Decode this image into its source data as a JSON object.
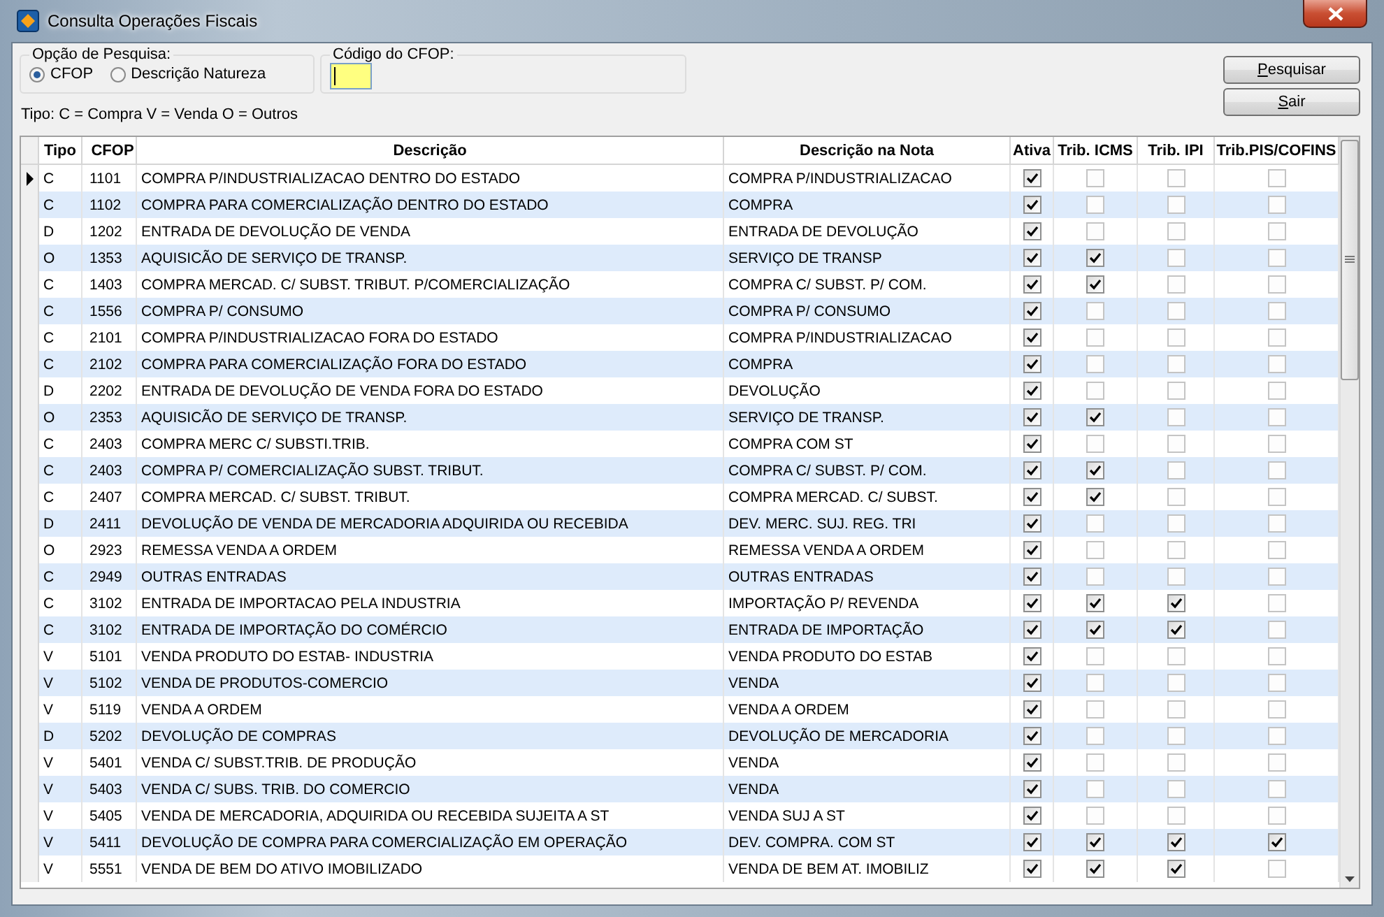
{
  "window": {
    "title": "Consulta Operações Fiscais"
  },
  "search_option": {
    "label": "Opção de Pesquisa:",
    "options": [
      {
        "label": "CFOP",
        "selected": true
      },
      {
        "label": "Descrição Natureza",
        "selected": false
      }
    ]
  },
  "cfop_code": {
    "label": "Código do CFOP:"
  },
  "buttons": [
    "Pesquisar",
    "Sair"
  ],
  "legend": "Tipo: C = Compra  V = Venda  O = Outros",
  "table": {
    "columns": [
      "Tipo",
      "CFOP",
      "Descrição",
      "Descrição na Nota",
      "Ativa",
      "Trib. ICMS",
      "Trib. IPI",
      "Trib.PIS/COFINS"
    ],
    "rows": [
      {
        "selected": true,
        "tipo": "C",
        "cfop": "1101",
        "descricao": "COMPRA P/INDUSTRIALIZACAO DENTRO DO ESTADO",
        "nota": "COMPRA P/INDUSTRIALIZACAO",
        "ativa": true,
        "icms": false,
        "ipi": false,
        "pis": false
      },
      {
        "selected": false,
        "tipo": "C",
        "cfop": "1102",
        "descricao": "COMPRA PARA COMERCIALIZAÇÃO DENTRO DO ESTADO",
        "nota": "COMPRA",
        "ativa": true,
        "icms": false,
        "ipi": false,
        "pis": false
      },
      {
        "selected": false,
        "tipo": "D",
        "cfop": "1202",
        "descricao": "ENTRADA DE DEVOLUÇÃO DE VENDA",
        "nota": "ENTRADA DE DEVOLUÇÃO",
        "ativa": true,
        "icms": false,
        "ipi": false,
        "pis": false
      },
      {
        "selected": false,
        "tipo": "O",
        "cfop": "1353",
        "descricao": "AQUISICÃO DE SERVIÇO DE TRANSP.",
        "nota": "SERVIÇO DE TRANSP",
        "ativa": true,
        "icms": true,
        "ipi": false,
        "pis": false
      },
      {
        "selected": false,
        "tipo": "C",
        "cfop": "1403",
        "descricao": "COMPRA MERCAD. C/ SUBST. TRIBUT. P/COMERCIALIZAÇÃO",
        "nota": "COMPRA C/ SUBST. P/ COM.",
        "ativa": true,
        "icms": true,
        "ipi": false,
        "pis": false
      },
      {
        "selected": false,
        "tipo": "C",
        "cfop": "1556",
        "descricao": "COMPRA P/ CONSUMO",
        "nota": "COMPRA P/ CONSUMO",
        "ativa": true,
        "icms": false,
        "ipi": false,
        "pis": false
      },
      {
        "selected": false,
        "tipo": "C",
        "cfop": "2101",
        "descricao": "COMPRA P/INDUSTRIALIZACAO FORA DO ESTADO",
        "nota": "COMPRA P/INDUSTRIALIZACAO",
        "ativa": true,
        "icms": false,
        "ipi": false,
        "pis": false
      },
      {
        "selected": false,
        "tipo": "C",
        "cfop": "2102",
        "descricao": "COMPRA PARA COMERCIALIZAÇÃO FORA DO ESTADO",
        "nota": "COMPRA",
        "ativa": true,
        "icms": false,
        "ipi": false,
        "pis": false
      },
      {
        "selected": false,
        "tipo": "D",
        "cfop": "2202",
        "descricao": "ENTRADA DE DEVOLUÇÃO DE VENDA FORA DO ESTADO",
        "nota": "DEVOLUÇÃO",
        "ativa": true,
        "icms": false,
        "ipi": false,
        "pis": false
      },
      {
        "selected": false,
        "tipo": "O",
        "cfop": "2353",
        "descricao": "AQUISICÃO DE SERVIÇO DE TRANSP.",
        "nota": "SERVIÇO DE TRANSP.",
        "ativa": true,
        "icms": true,
        "ipi": false,
        "pis": false
      },
      {
        "selected": false,
        "tipo": "C",
        "cfop": "2403",
        "descricao": "COMPRA MERC C/ SUBSTI.TRIB.",
        "nota": "COMPRA  COM ST",
        "ativa": true,
        "icms": false,
        "ipi": false,
        "pis": false
      },
      {
        "selected": false,
        "tipo": "C",
        "cfop": "2403",
        "descricao": "COMPRA P/ COMERCIALIZAÇÃO SUBST. TRIBUT.",
        "nota": "COMPRA C/ SUBST. P/ COM.",
        "ativa": true,
        "icms": true,
        "ipi": false,
        "pis": false
      },
      {
        "selected": false,
        "tipo": "C",
        "cfop": "2407",
        "descricao": "COMPRA MERCAD. C/ SUBST. TRIBUT.",
        "nota": "COMPRA MERCAD. C/ SUBST.",
        "ativa": true,
        "icms": true,
        "ipi": false,
        "pis": false
      },
      {
        "selected": false,
        "tipo": "D",
        "cfop": "2411",
        "descricao": "DEVOLUÇÃO DE VENDA DE MERCADORIA ADQUIRIDA OU RECEBIDA",
        "nota": "DEV. MERC. SUJ. REG. TRI",
        "ativa": true,
        "icms": false,
        "ipi": false,
        "pis": false
      },
      {
        "selected": false,
        "tipo": "O",
        "cfop": "2923",
        "descricao": "REMESSA VENDA A ORDEM",
        "nota": "REMESSA VENDA A ORDEM",
        "ativa": true,
        "icms": false,
        "ipi": false,
        "pis": false
      },
      {
        "selected": false,
        "tipo": "C",
        "cfop": "2949",
        "descricao": "OUTRAS ENTRADAS",
        "nota": "OUTRAS ENTRADAS",
        "ativa": true,
        "icms": false,
        "ipi": false,
        "pis": false
      },
      {
        "selected": false,
        "tipo": "C",
        "cfop": "3102",
        "descricao": "ENTRADA DE IMPORTACAO PELA INDUSTRIA",
        "nota": "IMPORTAÇÃO P/ REVENDA",
        "ativa": true,
        "icms": true,
        "ipi": true,
        "pis": false
      },
      {
        "selected": false,
        "tipo": "C",
        "cfop": "3102",
        "descricao": "ENTRADA DE IMPORTAÇÃO DO COMÉRCIO",
        "nota": "ENTRADA DE IMPORTAÇÃO",
        "ativa": true,
        "icms": true,
        "ipi": true,
        "pis": false
      },
      {
        "selected": false,
        "tipo": "V",
        "cfop": "5101",
        "descricao": "VENDA PRODUTO DO ESTAB- INDUSTRIA",
        "nota": "VENDA PRODUTO DO ESTAB",
        "ativa": true,
        "icms": false,
        "ipi": false,
        "pis": false
      },
      {
        "selected": false,
        "tipo": "V",
        "cfop": "5102",
        "descricao": "VENDA DE PRODUTOS-COMERCIO",
        "nota": "VENDA",
        "ativa": true,
        "icms": false,
        "ipi": false,
        "pis": false
      },
      {
        "selected": false,
        "tipo": "V",
        "cfop": "5119",
        "descricao": "VENDA A ORDEM",
        "nota": "VENDA A ORDEM",
        "ativa": true,
        "icms": false,
        "ipi": false,
        "pis": false
      },
      {
        "selected": false,
        "tipo": "D",
        "cfop": "5202",
        "descricao": "DEVOLUÇÃO DE COMPRAS",
        "nota": "DEVOLUÇÃO DE MERCADORIA",
        "ativa": true,
        "icms": false,
        "ipi": false,
        "pis": false
      },
      {
        "selected": false,
        "tipo": "V",
        "cfop": "5401",
        "descricao": "VENDA C/ SUBST.TRIB. DE PRODUÇÃO",
        "nota": "VENDA",
        "ativa": true,
        "icms": false,
        "ipi": false,
        "pis": false
      },
      {
        "selected": false,
        "tipo": "V",
        "cfop": "5403",
        "descricao": "VENDA C/ SUBS. TRIB. DO COMERCIO",
        "nota": "VENDA",
        "ativa": true,
        "icms": false,
        "ipi": false,
        "pis": false
      },
      {
        "selected": false,
        "tipo": "V",
        "cfop": "5405",
        "descricao": "VENDA DE MERCADORIA, ADQUIRIDA OU RECEBIDA SUJEITA A ST",
        "nota": "VENDA SUJ A ST",
        "ativa": true,
        "icms": false,
        "ipi": false,
        "pis": false
      },
      {
        "selected": false,
        "tipo": "V",
        "cfop": "5411",
        "descricao": "DEVOLUÇÃO DE COMPRA PARA COMERCIALIZAÇÃO EM OPERAÇÃO",
        "nota": "DEV. COMPRA. COM ST",
        "ativa": true,
        "icms": true,
        "ipi": true,
        "pis": true
      },
      {
        "selected": false,
        "tipo": "V",
        "cfop": "5551",
        "descricao": "VENDA DE BEM DO ATIVO IMOBILIZADO",
        "nota": "VENDA DE BEM AT. IMOBILIZ",
        "ativa": true,
        "icms": true,
        "ipi": true,
        "pis": false
      }
    ]
  }
}
